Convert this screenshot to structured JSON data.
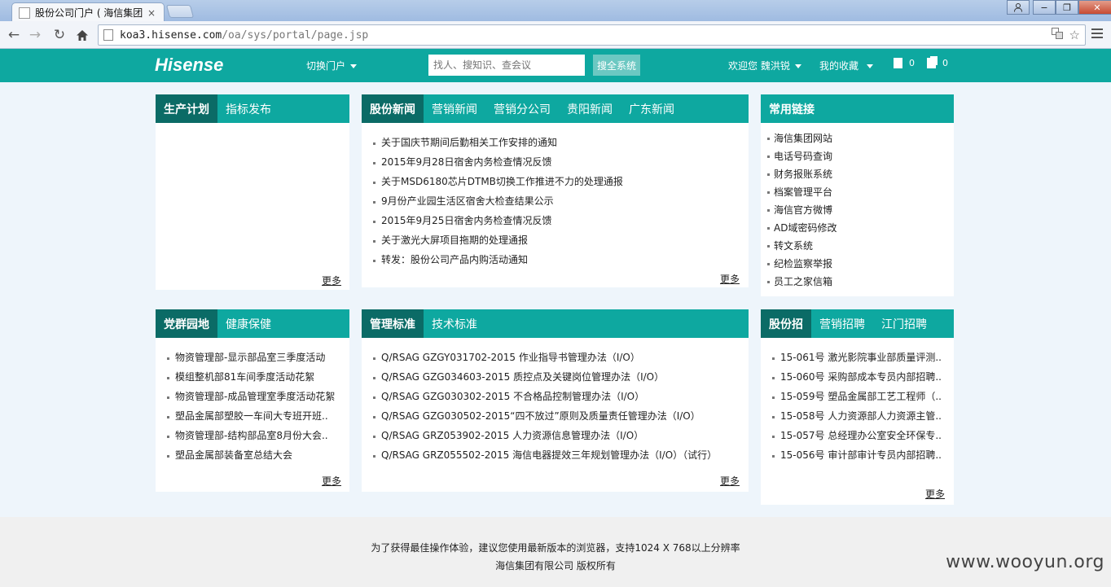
{
  "browser": {
    "tab_title": "股份公司门户 ( 海信集团 )",
    "tab_close": "×",
    "url_host": "koa3.hisense.com",
    "url_path": "/oa/sys/portal/page.jsp",
    "win_controls": [
      "−",
      "❐",
      "✕"
    ]
  },
  "header": {
    "logo": "Hisense",
    "switch_portal": "切换门户",
    "search_placeholder": "找人、搜知识、查会议",
    "search_button": "搜全系统",
    "welcome": "欢迎您 魏洪锐",
    "favorites": "我的收藏",
    "count_a": "0",
    "count_b": "0"
  },
  "panels": {
    "plan": {
      "tabs": [
        "生产计划",
        "指标发布"
      ],
      "items": [],
      "more": "更多"
    },
    "news": {
      "tabs": [
        "股份新闻",
        "营销新闻",
        "营销分公司",
        "贵阳新闻",
        "广东新闻"
      ],
      "items": [
        "关于国庆节期间后勤相关工作安排的通知",
        "2015年9月28日宿舍内务检查情况反馈",
        "关于MSD6180芯片DTMB切换工作推进不力的处理通报",
        "9月份产业园生活区宿舍大检查结果公示",
        "2015年9月25日宿舍内务检查情况反馈",
        "关于激光大屏项目拖期的处理通报",
        "转发：股份公司产品内购活动通知"
      ],
      "more": "更多"
    },
    "links": {
      "tabs": [
        "常用链接"
      ],
      "items": [
        "海信集团网站",
        "电话号码查询",
        "财务报账系统",
        "档案管理平台",
        "海信官方微博",
        " AD域密码修改",
        "转文系统",
        "纪检监察举报",
        "员工之家信箱"
      ]
    },
    "party": {
      "tabs": [
        "党群园地",
        "健康保健"
      ],
      "items": [
        "物资管理部-显示部品室三季度活动",
        "模组整机部81车间季度活动花絮",
        "物资管理部-成品管理室季度活动花絮",
        "塑品金属部塑胶一车间大专班开班..",
        "物资管理部-结构部品室8月份大会..",
        "塑品金属部装备室总结大会"
      ],
      "more": "更多"
    },
    "standards": {
      "tabs": [
        "管理标准",
        "技术标准"
      ],
      "items": [
        "Q/RSAG GZGY031702-2015 作业指导书管理办法（I/O）",
        "Q/RSAG GZG034603-2015 质控点及关键岗位管理办法（I/O）",
        "Q/RSAG GZG030302-2015 不合格品控制管理办法（I/O）",
        "Q/RSAG GZG030502-2015“四不放过”原则及质量责任管理办法（I/O）",
        "Q/RSAG GRZ053902-2015 人力资源信息管理办法（I/O）",
        "Q/RSAG GRZ055502-2015 海信电器提效三年规划管理办法（I/O）（试行）"
      ],
      "more": "更多"
    },
    "recruit": {
      "tabs": [
        "股份招",
        "营销招聘",
        "江门招聘"
      ],
      "items": [
        "15-061号 激光影院事业部质量评测..",
        "15-060号 采购部成本专员内部招聘..",
        "15-059号 塑品金属部工艺工程师（..",
        "15-058号 人力资源部人力资源主管..",
        "15-057号 总经理办公室安全环保专..",
        "15-056号 审计部审计专员内部招聘.."
      ],
      "more": "更多"
    }
  },
  "footer": {
    "line1": "为了获得最佳操作体验，建议您使用最新版本的浏览器，支持1024 X 768以上分辨率",
    "line2": "海信集团有限公司 版权所有"
  },
  "watermark": "www.wooyun.org"
}
